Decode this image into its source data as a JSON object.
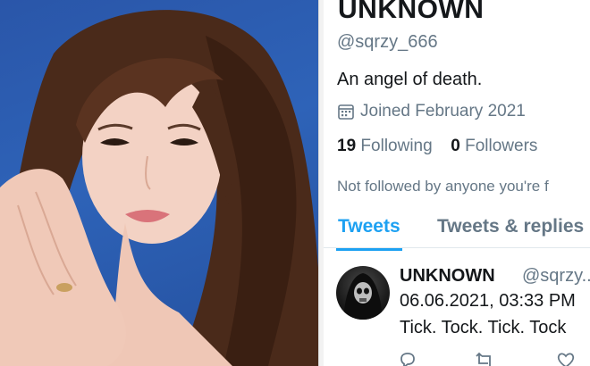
{
  "profile": {
    "display_name": "UNKNOWN",
    "handle": "@sqrzy_666",
    "bio": "An angel of death.",
    "joined": "Joined February 2021",
    "following_count": "19",
    "following_label": "Following",
    "followers_count": "0",
    "followers_label": "Followers",
    "not_followed_text": "Not followed by anyone you're f"
  },
  "tabs": [
    {
      "label": "Tweets",
      "active": true
    },
    {
      "label": "Tweets & replies",
      "active": false
    }
  ],
  "tweet": {
    "name": "UNKNOWN",
    "handle": "@sqrzy...",
    "timestamp": "06.06.2021, 03:33 PM",
    "text": "Tick. Tock. Tick. Tock"
  },
  "icons": {
    "calendar": "calendar-icon",
    "reply": "reply-icon",
    "retweet": "retweet-icon",
    "like": "like-icon"
  },
  "colors": {
    "accent": "#1da1f2",
    "secondary_text": "#657786",
    "primary_text": "#14171a",
    "photo_background": "#2e63b8"
  }
}
